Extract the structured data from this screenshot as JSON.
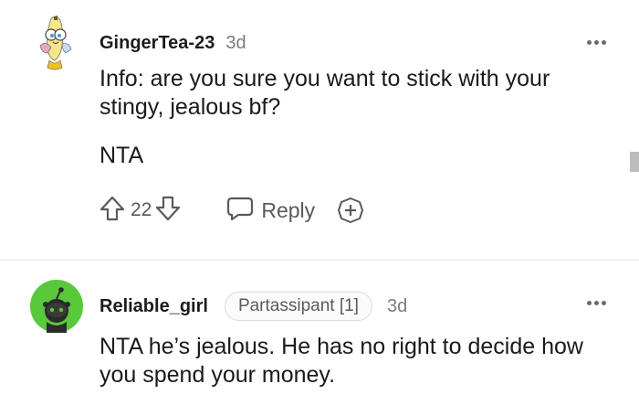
{
  "comments": [
    {
      "username": "GingerTea-23",
      "time": "3d",
      "body_lines": [
        "Info: are you sure you want to stick with your stingy, jealous bf?",
        "NTA"
      ],
      "score": "22",
      "reply_label": "Reply"
    },
    {
      "username": "Reliable_girl",
      "flair": "Partassipant [1]",
      "time": "3d",
      "body": "NTA he’s jealous. He has no right to decide how you spend your money."
    }
  ],
  "icons": [
    "banana-avatar-icon",
    "more-options-icon",
    "upvote-icon",
    "downvote-icon",
    "reply-icon",
    "award-icon",
    "snoo-avatar-icon"
  ],
  "colors": {
    "avatar_green": "#58c93a",
    "text": "#1a1a1b",
    "muted": "#7c7c7c"
  }
}
